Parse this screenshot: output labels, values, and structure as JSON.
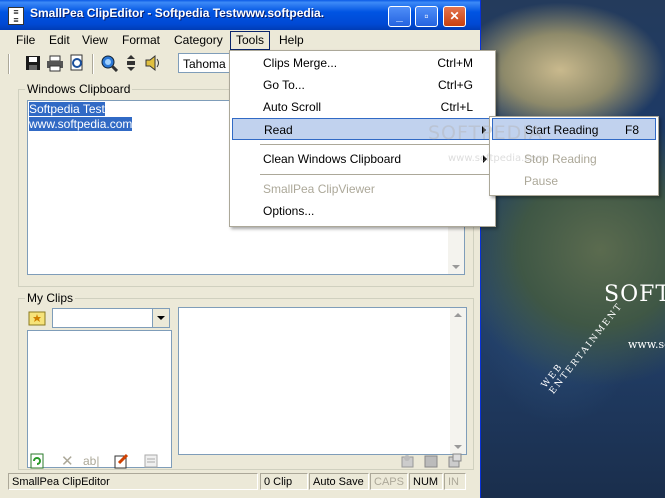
{
  "window": {
    "title": "SmallPea ClipEditor - Softpedia Testwww.softpedia."
  },
  "menubar": [
    "File",
    "Edit",
    "View",
    "Format",
    "Category",
    "Tools",
    "Help"
  ],
  "toolbar": {
    "font": "Tahoma"
  },
  "clipboard": {
    "label": "Windows Clipboard",
    "line1": "Softpedia Test",
    "line2": "www.softpedia.com"
  },
  "myclips": {
    "label": "My Clips"
  },
  "tools_menu": [
    {
      "label": "Clips Merge...",
      "shortcut": "Ctrl+M"
    },
    {
      "label": "Go To...",
      "shortcut": "Ctrl+G"
    },
    {
      "label": "Auto Scroll",
      "shortcut": "Ctrl+L"
    },
    {
      "label": "Read",
      "shortcut": ""
    },
    {
      "label": "Clean Windows Clipboard",
      "shortcut": ""
    },
    {
      "label": "SmallPea ClipViewer",
      "shortcut": ""
    },
    {
      "label": "Options...",
      "shortcut": ""
    }
  ],
  "read_submenu": [
    {
      "label": "Start Reading",
      "shortcut": "F8"
    },
    {
      "label": "Stop Reading",
      "shortcut": ""
    },
    {
      "label": "Pause",
      "shortcut": ""
    }
  ],
  "statusbar": {
    "app": "SmallPea ClipEditor",
    "clips": "0 Clip",
    "autosave": "Auto Save",
    "caps": "CAPS",
    "num": "NUM",
    "ins": "IN"
  },
  "desktop": {
    "brand": "SOFT",
    "url": "www.so",
    "tagline": "WEB ENTERTAINMENT"
  },
  "watermark": {
    "logo": "SOFTPEDIA",
    "url": "www.softpedia.com"
  },
  "colors": {
    "selection": "#316ac5",
    "titlebar": "#0054e3",
    "menu_highlight": "#c1d2ee"
  }
}
